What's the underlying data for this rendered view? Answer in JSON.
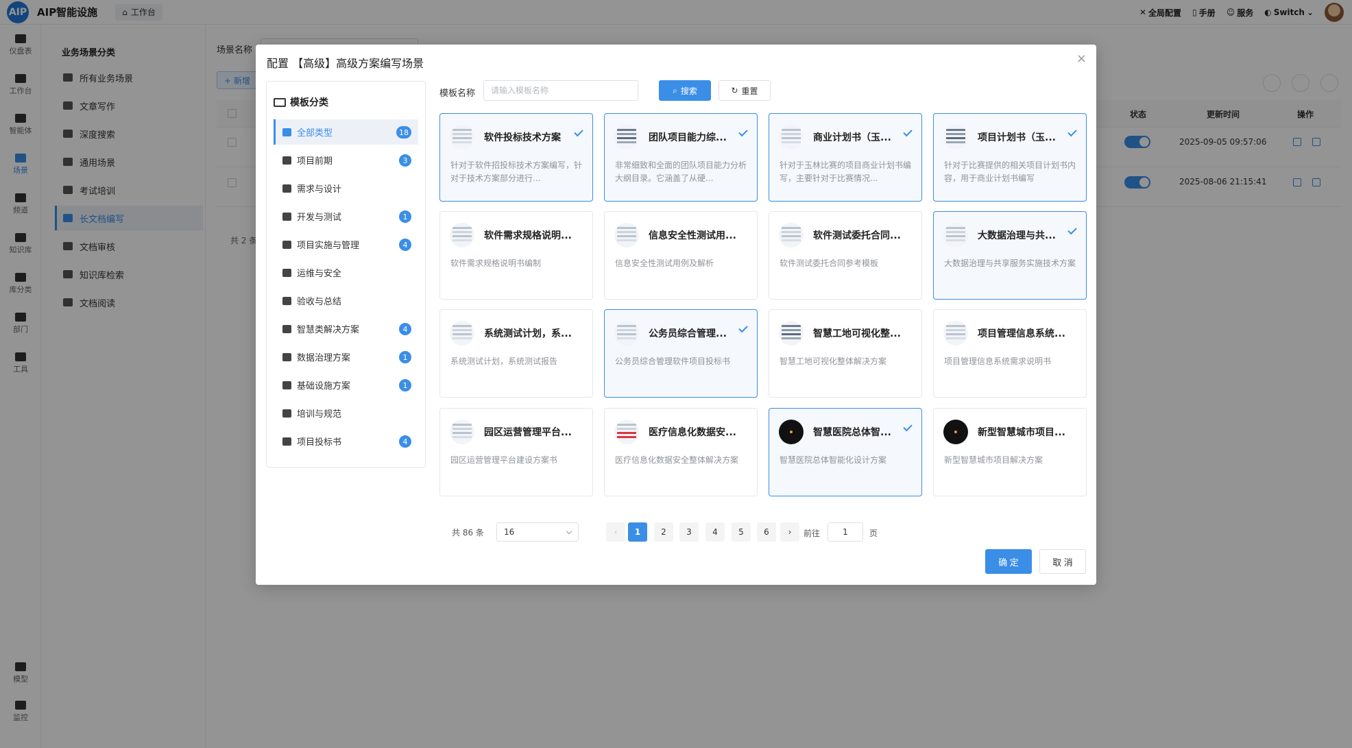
{
  "topbar": {
    "logo": "AIP",
    "app_title": "AIP智能设施",
    "workbench_tab": "工作台",
    "right_items": [
      {
        "icon": "tools-icon",
        "label": "全局配置"
      },
      {
        "icon": "manual-icon",
        "label": "手册"
      },
      {
        "icon": "service-icon",
        "label": "服务"
      },
      {
        "icon": "shield-icon",
        "label": "Switch"
      }
    ]
  },
  "rail": {
    "items": [
      {
        "icon": "dashboard-icon",
        "label": "仪盘表"
      },
      {
        "icon": "workbench-icon",
        "label": "工作台"
      },
      {
        "icon": "agent-icon",
        "label": "智能体"
      },
      {
        "icon": "scene-icon",
        "label": "场景"
      },
      {
        "icon": "channel-icon",
        "label": "频道"
      },
      {
        "icon": "knowledge-icon",
        "label": "知识库"
      },
      {
        "icon": "library-icon",
        "label": "库分类"
      },
      {
        "icon": "department-icon",
        "label": "部门"
      },
      {
        "icon": "tool-icon",
        "label": "工具"
      },
      {
        "icon": "model-icon",
        "label": "模型"
      },
      {
        "icon": "monitor-icon",
        "label": "监控"
      }
    ]
  },
  "sidebar": {
    "title": "业务场景分类",
    "items": [
      {
        "icon": "layers-icon",
        "label": "所有业务场景"
      },
      {
        "icon": "pen-icon",
        "label": "文章写作"
      },
      {
        "icon": "search-icon",
        "label": "深度搜索"
      },
      {
        "icon": "gears-icon",
        "label": "通用场景"
      },
      {
        "icon": "grad-cap-icon",
        "label": "考试培训"
      },
      {
        "icon": "share-icon",
        "label": "长文档编写"
      },
      {
        "icon": "doc-icon",
        "label": "文档审核"
      },
      {
        "icon": "chart-icon",
        "label": "知识库检索"
      },
      {
        "icon": "reader-icon",
        "label": "文档阅读"
      }
    ]
  },
  "main": {
    "scene_name_label": "场景名称",
    "add_button": "+ 新增",
    "table_headers": {
      "status": "状态",
      "updated": "更新时间",
      "actions": "操作"
    },
    "rows": [
      {
        "updated": "2025-09-05 09:57:06"
      },
      {
        "updated": "2025-08-06 21:15:41"
      }
    ],
    "total": "共 2 条"
  },
  "modal": {
    "title": "配置 【高级】高级方案编写场景",
    "close": "×",
    "category_header": "模板分类",
    "categories": [
      {
        "icon": "home-icon",
        "label": "全部类型",
        "count": "18"
      },
      {
        "icon": "cubes-icon",
        "label": "项目前期",
        "count": "3"
      },
      {
        "icon": "design-icon",
        "label": "需求与设计",
        "count": ""
      },
      {
        "icon": "branch-icon",
        "label": "开发与测试",
        "count": "1"
      },
      {
        "icon": "network-icon",
        "label": "项目实施与管理",
        "count": "4"
      },
      {
        "icon": "shield-icon",
        "label": "运维与安全",
        "count": ""
      },
      {
        "icon": "clipboard-icon",
        "label": "验收与总结",
        "count": ""
      },
      {
        "icon": "bulb-icon",
        "label": "智慧类解决方案",
        "count": "4"
      },
      {
        "icon": "database-icon",
        "label": "数据治理方案",
        "count": "1"
      },
      {
        "icon": "server-icon",
        "label": "基础设施方案",
        "count": "1"
      },
      {
        "icon": "training-icon",
        "label": "培训与规范",
        "count": ""
      },
      {
        "icon": "file-icon",
        "label": "项目投标书",
        "count": "4"
      }
    ],
    "search": {
      "label": "模板名称",
      "placeholder": "请输入模板名称",
      "search_button": "搜索",
      "reset_button": "重置"
    },
    "cards": [
      {
        "title": "软件投标技术方案",
        "desc": "针对于软件招投标技术方案编写，针对于技术方案部分进行...",
        "selected": true,
        "thumb": "doc"
      },
      {
        "title": "团队项目能力综...",
        "desc": "非常细致和全面的团队项目能力分析大纲目录。它涵盖了从硬...",
        "selected": true,
        "thumb": "photo"
      },
      {
        "title": "商业计划书（玉...",
        "desc": "针对于玉林比赛的项目商业计划书编写，主要针对于比赛情况...",
        "selected": true,
        "thumb": "doc"
      },
      {
        "title": "项目计划书（玉...",
        "desc": "针对于比赛提供的相关项目计划书内容，用于商业计划书编写",
        "selected": true,
        "thumb": "photo"
      },
      {
        "title": "软件需求规格说明...",
        "desc": "软件需求规格说明书编制",
        "selected": false,
        "thumb": "doc"
      },
      {
        "title": "信息安全性测试用...",
        "desc": "信息安全性测试用例及解析",
        "selected": false,
        "thumb": "doc"
      },
      {
        "title": "软件测试委托合同...",
        "desc": "软件测试委托合同参考模板",
        "selected": false,
        "thumb": "doc"
      },
      {
        "title": "大数据治理与共...",
        "desc": "大数据治理与共享服务实施技术方案",
        "selected": true,
        "thumb": "doc"
      },
      {
        "title": "系统测试计划，系...",
        "desc": "系统测试计划，系统测试报告",
        "selected": false,
        "thumb": "doc"
      },
      {
        "title": "公务员综合管理...",
        "desc": "公务员综合管理软件项目投标书",
        "selected": true,
        "thumb": "doc"
      },
      {
        "title": "智慧工地可视化整...",
        "desc": "智慧工地可视化整体解决方案",
        "selected": false,
        "thumb": "photo"
      },
      {
        "title": "项目管理信息系统...",
        "desc": "项目管理信息系统需求说明书",
        "selected": false,
        "thumb": "doc"
      },
      {
        "title": "园区运营管理平台...",
        "desc": "园区运营管理平台建设方案书",
        "selected": false,
        "thumb": "doc"
      },
      {
        "title": "医疗信息化数据安...",
        "desc": "医疗信息化数据安全整体解决方案",
        "selected": false,
        "thumb": "red"
      },
      {
        "title": "智慧医院总体智...",
        "desc": "智慧医院总体智能化设计方案",
        "selected": true,
        "thumb": "dark"
      },
      {
        "title": "新型智慧城市项目...",
        "desc": "新型智慧城市项目解决方案",
        "selected": false,
        "thumb": "dark"
      }
    ],
    "pager": {
      "total": "共 86 条",
      "page_size": "16",
      "pages": [
        "1",
        "2",
        "3",
        "4",
        "5",
        "6"
      ],
      "current": "1",
      "prev": "‹",
      "next": "›",
      "goto_label": "前往",
      "goto_value": "1",
      "goto_suffix": "页"
    },
    "ok_button": "确 定",
    "cancel_button": "取 消"
  }
}
